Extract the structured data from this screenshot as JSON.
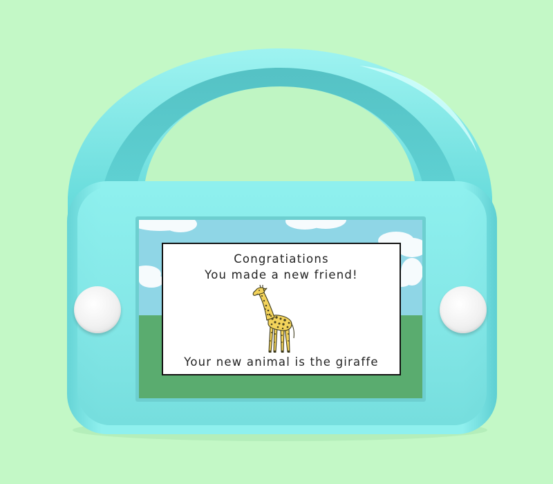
{
  "colors": {
    "background": "#c3f8c6",
    "device_body": "#86e8e8",
    "handle": "#7ee9e9",
    "sky": "#8fd6e6",
    "cloud": "#f6fbfd",
    "grass": "#5aac6f",
    "giraffe_body": "#f3d35b",
    "giraffe_spots": "#4a4420"
  },
  "device": {
    "left_button_icon": "round-button",
    "right_button_icon": "round-button"
  },
  "dialog": {
    "title": "Congratiations",
    "subtitle": "You made a new friend!",
    "animal_message": "Your new animal is the giraffe",
    "animal_icon": "giraffe-icon"
  }
}
